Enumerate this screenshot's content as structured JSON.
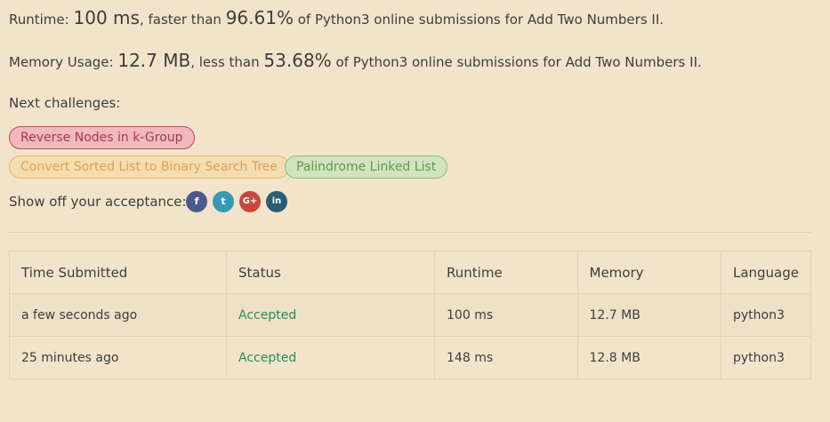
{
  "runtime": {
    "label": "Runtime:",
    "value": "100 ms",
    "mid": ", faster than",
    "percent": "96.61%",
    "suffix": "of Python3 online submissions for Add Two Numbers II."
  },
  "memory": {
    "label": "Memory Usage:",
    "value": "12.7 MB",
    "mid": ", less than",
    "percent": "53.68%",
    "suffix": "of Python3 online submissions for Add Two Numbers II."
  },
  "next_challenges": {
    "label": "Next challenges:",
    "items": [
      {
        "label": "Reverse Nodes in k-Group",
        "difficulty": "hard"
      },
      {
        "label": "Convert Sorted List to Binary Search Tree",
        "difficulty": "medium"
      },
      {
        "label": "Palindrome Linked List",
        "difficulty": "easy"
      }
    ]
  },
  "share": {
    "label": "Show off your acceptance:",
    "icons": [
      {
        "name": "facebook-icon",
        "glyph": "f",
        "color": "#4a5a8c"
      },
      {
        "name": "twitter-icon",
        "glyph": "t",
        "color": "#3799b4"
      },
      {
        "name": "google-plus-icon",
        "glyph": "G+",
        "color": "#c9473d"
      },
      {
        "name": "linkedin-icon",
        "glyph": "in",
        "color": "#2c5d76"
      }
    ]
  },
  "table": {
    "headers": [
      "Time Submitted",
      "Status",
      "Runtime",
      "Memory",
      "Language"
    ],
    "rows": [
      [
        "a few seconds ago",
        "Accepted",
        "100 ms",
        "12.7 MB",
        "python3"
      ],
      [
        "25 minutes ago",
        "Accepted",
        "148 ms",
        "12.8 MB",
        "python3"
      ]
    ]
  },
  "colors": {
    "background": "#f2e4cb",
    "accepted": "#2c8a5a"
  }
}
